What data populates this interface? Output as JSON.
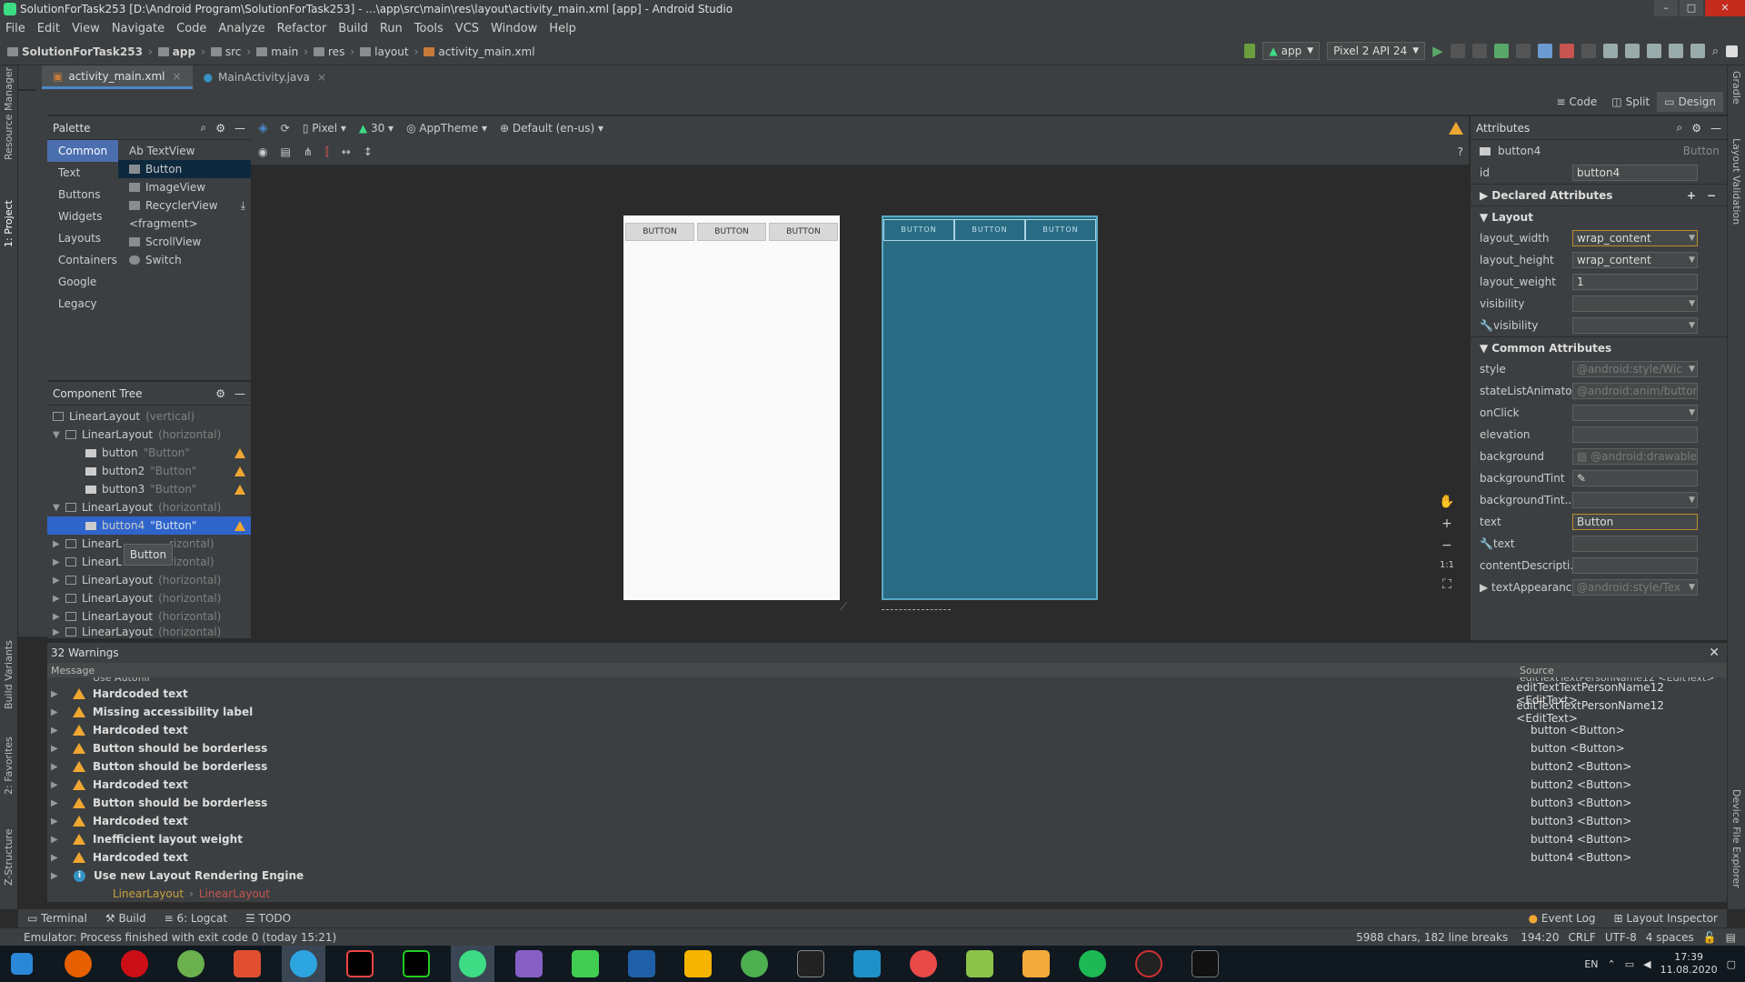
{
  "window": {
    "title": "SolutionForTask253 [D:\\Android Program\\SolutionForTask253] - ...\\app\\src\\main\\res\\layout\\activity_main.xml [app] - Android Studio"
  },
  "menu": [
    "File",
    "Edit",
    "View",
    "Navigate",
    "Code",
    "Analyze",
    "Refactor",
    "Build",
    "Run",
    "Tools",
    "VCS",
    "Window",
    "Help"
  ],
  "breadcrumbs": [
    "SolutionForTask253",
    "app",
    "src",
    "main",
    "res",
    "layout",
    "activity_main.xml"
  ],
  "run": {
    "config": "app",
    "device": "Pixel 2 API 24"
  },
  "left_tools": [
    "Resource Manager",
    "1: Project"
  ],
  "left_bottom_tools": [
    "Build Variants",
    "2: Favorites",
    "Z-Structure"
  ],
  "right_tools": [
    "Gradle",
    "Layout Validation",
    "Device File Explorer"
  ],
  "editor_tabs": [
    {
      "label": "activity_main.xml",
      "active": true
    },
    {
      "label": "MainActivity.java",
      "active": false
    }
  ],
  "modes": [
    "Code",
    "Split",
    "Design"
  ],
  "palette": {
    "title": "Palette",
    "categories": [
      "Common",
      "Text",
      "Buttons",
      "Widgets",
      "Layouts",
      "Containers",
      "Google",
      "Legacy"
    ],
    "items": [
      "Ab TextView",
      "Button",
      "ImageView",
      "RecyclerView",
      "<fragment>",
      "ScrollView",
      "Switch"
    ]
  },
  "design_toolbar": {
    "device": "Pixel",
    "api": "30",
    "theme": "AppTheme",
    "locale": "Default (en-us)"
  },
  "preview": {
    "button_label": "BUTTON"
  },
  "tree": {
    "title": "Component Tree",
    "nodes": [
      {
        "name": "LinearLayout",
        "sub": "(vertical)"
      },
      {
        "name": "LinearLayout",
        "sub": "(horizontal)"
      },
      {
        "name": "button",
        "sub": "\"Button\""
      },
      {
        "name": "button2",
        "sub": "\"Button\""
      },
      {
        "name": "button3",
        "sub": "\"Button\""
      },
      {
        "name": "LinearLayout",
        "sub": "(horizontal)"
      },
      {
        "name": "button4",
        "sub": "\"Button\""
      },
      {
        "name": "LinearL",
        "sub": "rizontal)"
      },
      {
        "name": "LinearL",
        "sub": "rizontal)"
      },
      {
        "name": "LinearLayout",
        "sub": "(horizontal)"
      },
      {
        "name": "LinearLayout",
        "sub": "(horizontal)"
      },
      {
        "name": "LinearLayout",
        "sub": "(horizontal)"
      },
      {
        "name": "LinearLayout",
        "sub": "(horizontal)"
      }
    ],
    "tooltip": "Button"
  },
  "attributes": {
    "title": "Attributes",
    "component": "button4",
    "type": "Button",
    "id_label": "id",
    "id_value": "button4",
    "declared": "Declared Attributes",
    "layout_section": "Layout",
    "layout": [
      {
        "label": "layout_width",
        "value": "wrap_content"
      },
      {
        "label": "layout_height",
        "value": "wrap_content"
      },
      {
        "label": "layout_weight",
        "value": "1"
      },
      {
        "label": "visibility",
        "value": ""
      },
      {
        "label": "visibility",
        "value": ""
      }
    ],
    "common_section": "Common Attributes",
    "common": [
      {
        "label": "style",
        "value": "@android:style/Wic"
      },
      {
        "label": "stateListAnimator",
        "value": "@android:anim/button_s"
      },
      {
        "label": "onClick",
        "value": ""
      },
      {
        "label": "elevation",
        "value": ""
      },
      {
        "label": "background",
        "value": "@android:drawable/b"
      },
      {
        "label": "backgroundTint",
        "value": ""
      },
      {
        "label": "backgroundTint...",
        "value": ""
      },
      {
        "label": "text",
        "value": "Button"
      },
      {
        "label": "text",
        "value": ""
      },
      {
        "label": "contentDescripti...",
        "value": ""
      },
      {
        "label": "textAppearance",
        "value": "@android:style/Tex"
      }
    ]
  },
  "warnings": {
    "title": "32 Warnings",
    "col_message": "Message",
    "col_source": "Source",
    "partial_top": "Use Autofill",
    "partial_source": "editTextTextPersonName12 <EditText>",
    "rows": [
      {
        "type": "warn",
        "msg": "Hardcoded text",
        "src": "editTextTextPersonName12 <EditText>"
      },
      {
        "type": "warn",
        "msg": "Missing accessibility label",
        "src": "editTextTextPersonName12 <EditText>"
      },
      {
        "type": "warn",
        "msg": "Hardcoded text",
        "src": "button <Button>"
      },
      {
        "type": "warn",
        "msg": "Button should be borderless",
        "src": "button <Button>"
      },
      {
        "type": "warn",
        "msg": "Button should be borderless",
        "src": "button2 <Button>"
      },
      {
        "type": "warn",
        "msg": "Hardcoded text",
        "src": "button2 <Button>"
      },
      {
        "type": "warn",
        "msg": "Button should be borderless",
        "src": "button3 <Button>"
      },
      {
        "type": "warn",
        "msg": "Hardcoded text",
        "src": "button3 <Button>"
      },
      {
        "type": "warn",
        "msg": "Inefficient layout weight",
        "src": "button4 <Button>"
      },
      {
        "type": "warn",
        "msg": "Hardcoded text",
        "src": "button4 <Button>"
      },
      {
        "type": "info",
        "msg": "Use new Layout Rendering Engine",
        "src": ""
      }
    ],
    "path": [
      "LinearLayout",
      "LinearLayout"
    ]
  },
  "bottom_tools": [
    "Terminal",
    "Build",
    "6: Logcat",
    "TODO"
  ],
  "bottom_right_tools": [
    "Event Log",
    "Layout Inspector"
  ],
  "status": {
    "message": "Emulator: Process finished with exit code 0 (today 15:21)",
    "chars": "5988 chars, 182 line breaks",
    "pos": "194:20",
    "eol": "CRLF",
    "enc": "UTF-8",
    "indent": "4 spaces"
  },
  "taskbar": {
    "lang": "EN",
    "time": "17:39",
    "date": "11.08.2020"
  },
  "colors": {
    "accent": "#4a88c7",
    "selection": "#2f65ca",
    "warning": "#f0a732",
    "blueprint": "#296b83"
  }
}
